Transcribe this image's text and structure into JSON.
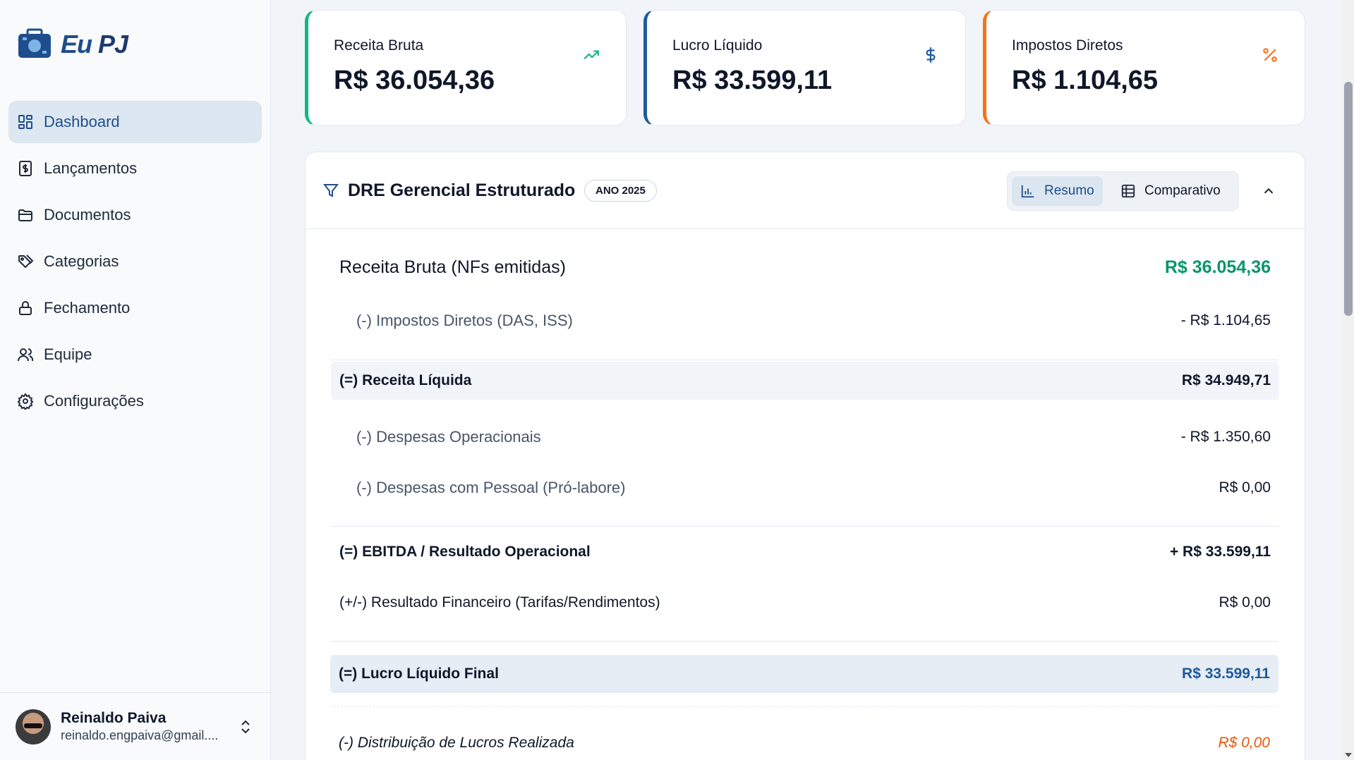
{
  "app": {
    "logo_text_eu": "Eu",
    "logo_text_pj": "PJ"
  },
  "sidebar": {
    "items": [
      {
        "label": "Dashboard",
        "icon": "dashboard-icon",
        "active": true
      },
      {
        "label": "Lançamentos",
        "icon": "receipt-icon"
      },
      {
        "label": "Documentos",
        "icon": "folder-icon"
      },
      {
        "label": "Categorias",
        "icon": "tags-icon"
      },
      {
        "label": "Fechamento",
        "icon": "lock-icon"
      },
      {
        "label": "Equipe",
        "icon": "users-icon"
      },
      {
        "label": "Configurações",
        "icon": "gear-icon"
      }
    ]
  },
  "user": {
    "name": "Reinaldo Paiva",
    "email": "reinaldo.engpaiva@gmail...."
  },
  "cards": [
    {
      "label": "Receita Bruta",
      "value": "R$ 36.054,36",
      "icon": "trending-up-icon",
      "accent": "#10b981"
    },
    {
      "label": "Lucro Líquido",
      "value": "R$ 33.599,11",
      "icon": "dollar-icon",
      "accent": "#1e5a9c"
    },
    {
      "label": "Impostos Diretos",
      "value": "R$ 1.104,65",
      "icon": "percent-icon",
      "accent": "#f97316"
    }
  ],
  "dre": {
    "title": "DRE Gerencial Estruturado",
    "year_badge": "ANO 2025",
    "view_resumo": "Resumo",
    "view_comparativo": "Comparativo",
    "rows": {
      "receita_bruta": {
        "label": "Receita Bruta (NFs emitidas)",
        "value": "R$ 36.054,36"
      },
      "impostos": {
        "label": "(-) Impostos Diretos (DAS, ISS)",
        "value": "- R$ 1.104,65"
      },
      "receita_liquida": {
        "label": "(=) Receita Líquida",
        "value": "R$ 34.949,71"
      },
      "despesas_operacionais": {
        "label": "(-) Despesas Operacionais",
        "value": "- R$ 1.350,60"
      },
      "despesas_pessoal": {
        "label": "(-) Despesas com Pessoal (Pró-labore)",
        "value": "R$ 0,00"
      },
      "ebitda": {
        "label": "(=) EBITDA / Resultado Operacional",
        "value": "+ R$ 33.599,11"
      },
      "resultado_financeiro": {
        "label": "(+/-) Resultado Financeiro (Tarifas/Rendimentos)",
        "value": "R$ 0,00"
      },
      "lucro_liquido": {
        "label": "(=) Lucro Líquido Final",
        "value": "R$ 33.599,11"
      },
      "distribuicao": {
        "label": "(-) Distribuição de Lucros Realizada",
        "value": "R$ 0,00"
      }
    }
  },
  "colors": {
    "brand": "#1e4e8c",
    "positive": "#059669",
    "warning": "#ea580c"
  }
}
